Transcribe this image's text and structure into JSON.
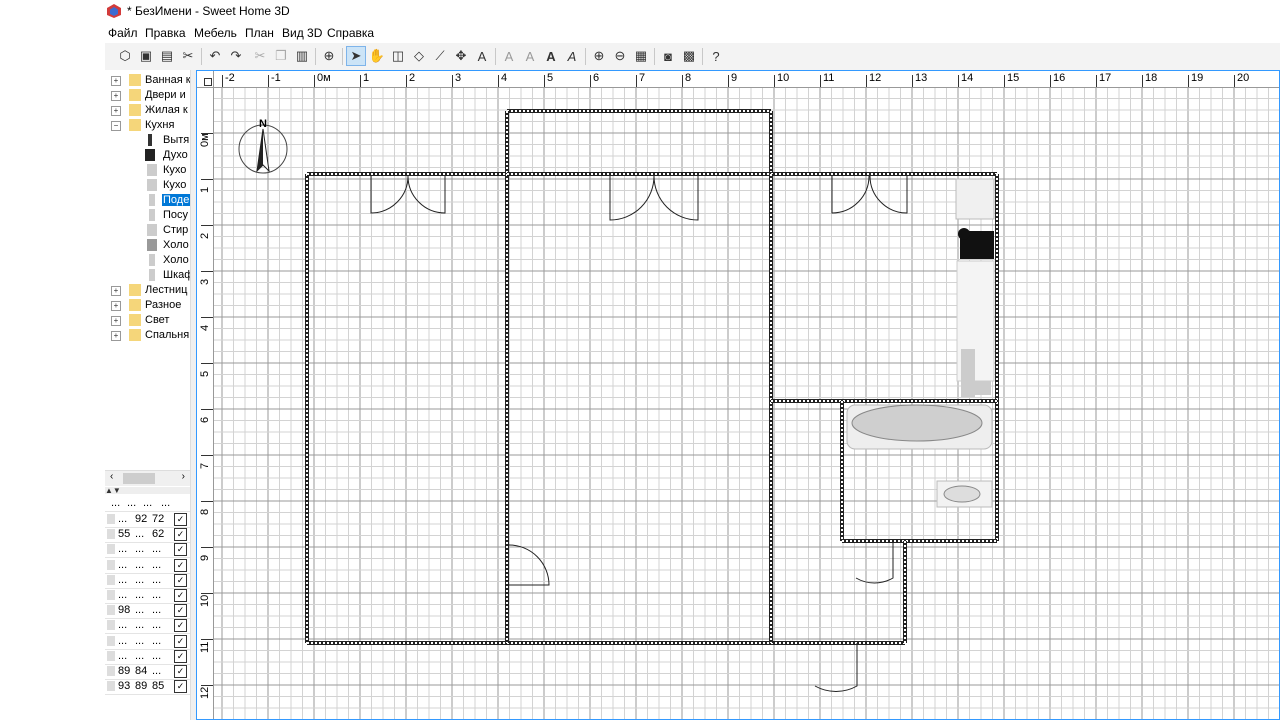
{
  "window": {
    "title": "* БезИмени - Sweet Home 3D"
  },
  "menu": [
    "Файл",
    "Правка",
    "Мебель",
    "План",
    "Вид 3D",
    "Справка"
  ],
  "catalog": {
    "categories": [
      {
        "label": "Ванная к",
        "expanded": false
      },
      {
        "label": "Двери и",
        "expanded": false
      },
      {
        "label": "Жилая к",
        "expanded": false
      },
      {
        "label": "Кухня",
        "expanded": true,
        "items": [
          "Вытя",
          "Духо",
          "Кухо",
          "Кухо",
          "Поде",
          "Посу",
          "Стир",
          "Холо",
          "Холо",
          "Шкаф"
        ],
        "selected_index": 4
      },
      {
        "label": "Лестниц",
        "expanded": false
      },
      {
        "label": "Разное",
        "expanded": false
      },
      {
        "label": "Свет",
        "expanded": false
      },
      {
        "label": "Спальня",
        "expanded": false
      }
    ]
  },
  "furniture_table": {
    "header": [
      "...",
      "...",
      "...",
      "..."
    ],
    "rows": [
      [
        "...",
        "92",
        "72"
      ],
      [
        "55",
        "...",
        "62"
      ],
      [
        "...",
        "...",
        "..."
      ],
      [
        "...",
        "...",
        "..."
      ],
      [
        "...",
        "...",
        "..."
      ],
      [
        "...",
        "...",
        "..."
      ],
      [
        "98",
        "...",
        "..."
      ],
      [
        "...",
        "...",
        "..."
      ],
      [
        "...",
        "...",
        "..."
      ],
      [
        "...",
        "...",
        "..."
      ],
      [
        "89",
        "84",
        "..."
      ],
      [
        "93",
        "89",
        "85"
      ]
    ]
  },
  "ruler": {
    "x_labels": [
      "-2",
      "-1",
      "0м",
      "1",
      "2",
      "3",
      "4",
      "5",
      "6",
      "7",
      "8",
      "9",
      "10",
      "11",
      "12",
      "13",
      "14",
      "15",
      "16",
      "17",
      "18",
      "19",
      "20"
    ],
    "y_labels": [
      "0м",
      "1",
      "2",
      "3",
      "4",
      "5",
      "6",
      "7",
      "8",
      "9",
      "10",
      "11",
      "12"
    ]
  },
  "compass": {
    "label": "N"
  }
}
